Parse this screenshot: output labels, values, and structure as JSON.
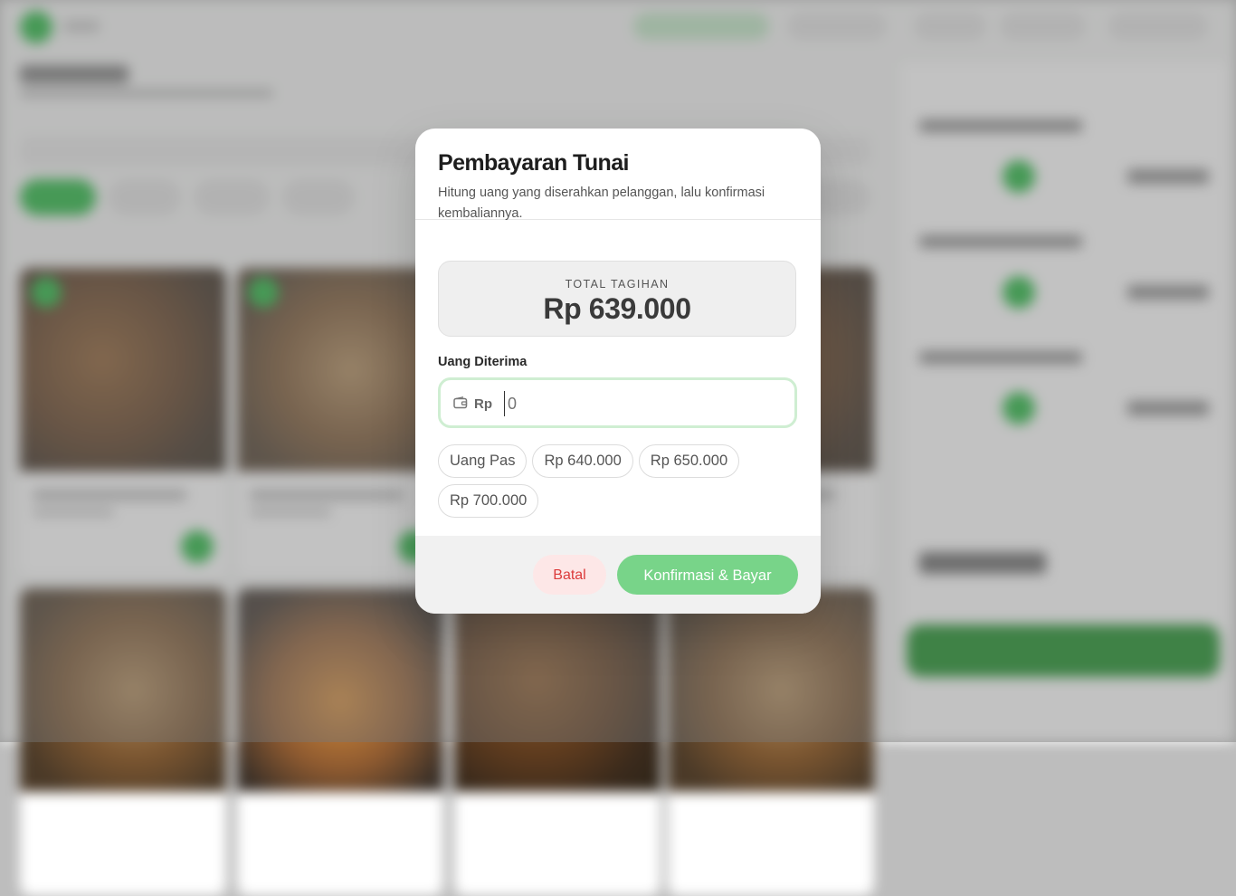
{
  "modal": {
    "title": "Pembayaran Tunai",
    "description": "Hitung uang yang diserahkan pelanggan, lalu konfirmasi kembaliannya.",
    "total_label": "TOTAL TAGIHAN",
    "total_value": "Rp 639.000",
    "field_label": "Uang Diterima",
    "currency_prefix": "Rp",
    "input_value": "",
    "input_placeholder": "0",
    "quick_amounts": [
      "Uang Pas",
      "Rp 640.000",
      "Rp 650.000",
      "Rp 700.000"
    ],
    "cancel_label": "Batal",
    "confirm_label": "Konfirmasi & Bayar"
  },
  "icons": {
    "wallet": "wallet-icon"
  },
  "colors": {
    "brand_green": "#1fb53b",
    "confirm_button": "#78d489",
    "cancel_text": "#dc3b3b",
    "cancel_bg": "#fde7e7",
    "input_focus_border": "#cfeed2"
  }
}
